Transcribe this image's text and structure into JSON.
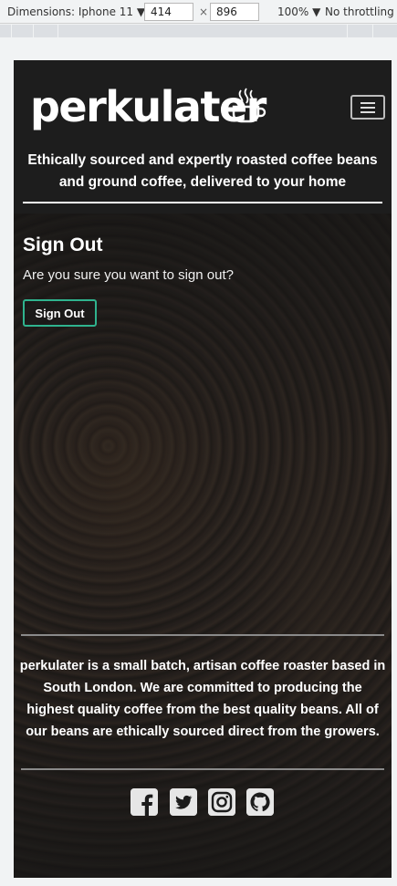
{
  "devtools": {
    "dimensions_label": "Dimensions: Iphone 11",
    "width": "414",
    "height": "896",
    "times": "×",
    "zoom": "100%",
    "throttling": "No throttling"
  },
  "header": {
    "brand": "perkulater",
    "tagline": "Ethically sourced and expertly roasted coffee beans and ground coffee, delivered to your home"
  },
  "signout": {
    "title": "Sign Out",
    "message": "Are you sure you want to sign out?",
    "button_label": "Sign Out",
    "accent_color": "#2fb38e"
  },
  "footer": {
    "about": "perkulater is a small batch, artisan coffee roaster based in South London. We are committed to producing the highest quality coffee from the best quality beans. All of our beans are ethically sourced direct from the growers.",
    "social_icons": [
      "facebook-icon",
      "twitter-icon",
      "instagram-icon",
      "github-icon"
    ]
  }
}
